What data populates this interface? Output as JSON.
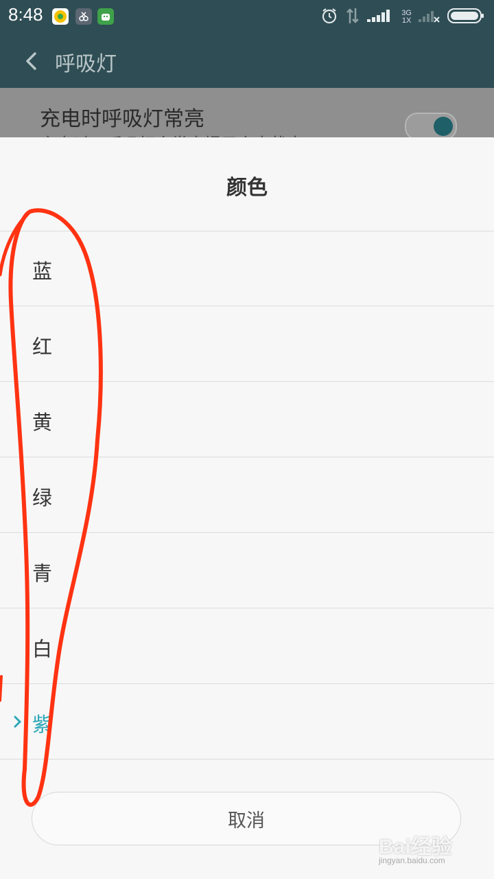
{
  "status_bar": {
    "time": "8:48",
    "network_type": "3G",
    "sim_slot": "1X",
    "icons": [
      "app-music-icon",
      "app-scissors-icon",
      "app-android-icon",
      "alarm-icon",
      "data-arrows-icon",
      "signal-icon",
      "signal-empty-icon",
      "battery-icon"
    ]
  },
  "app_bar": {
    "title": "呼吸灯",
    "back_icon": "chevron-left-icon"
  },
  "background_setting": {
    "title": "充电时呼吸灯常亮",
    "subtitle": "充电时，呼吸灯会常亮提示充电状态",
    "toggle_on": true
  },
  "dialog": {
    "title": "颜色",
    "options": [
      {
        "label": "蓝",
        "selected": false
      },
      {
        "label": "红",
        "selected": false
      },
      {
        "label": "黄",
        "selected": false
      },
      {
        "label": "绿",
        "selected": false
      },
      {
        "label": "青",
        "selected": false
      },
      {
        "label": "白",
        "selected": false
      },
      {
        "label": "紫",
        "selected": true
      }
    ],
    "cancel_label": "取消"
  },
  "colors": {
    "status_bar": "#2f4d54",
    "accent": "#2fa8b8",
    "annotation": "#ff3312"
  },
  "watermark": {
    "logo": "Bai经验",
    "url": "jingyan.baidu.com"
  }
}
